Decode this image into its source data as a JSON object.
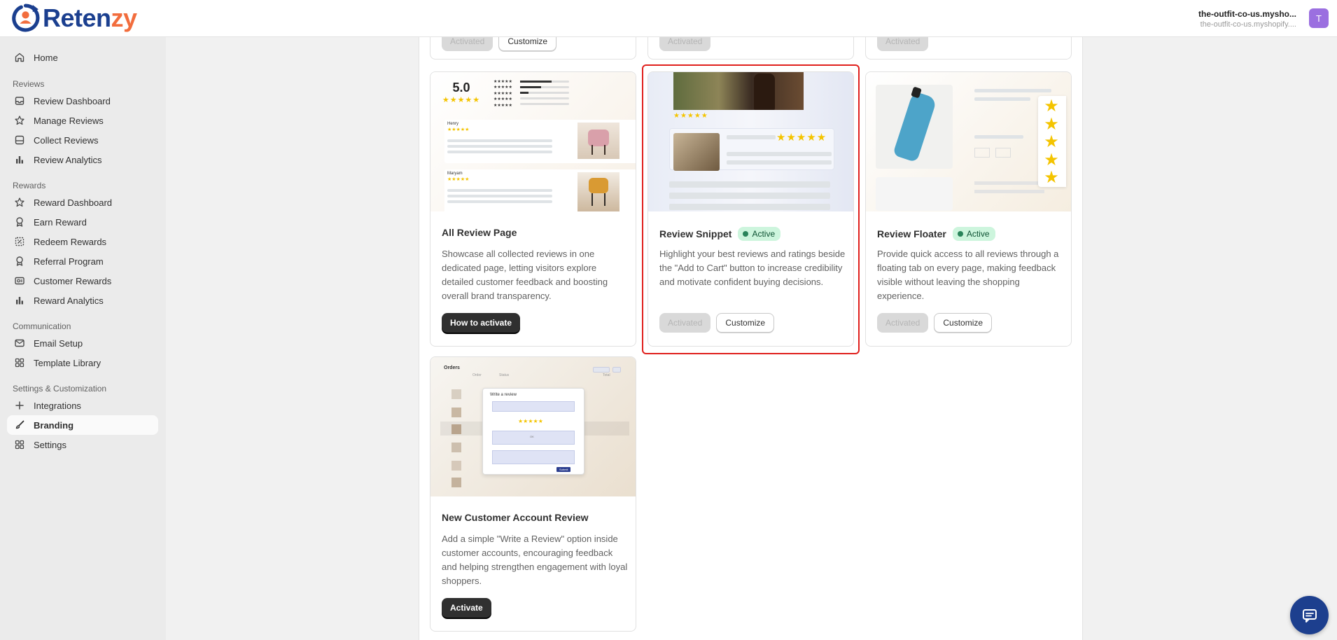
{
  "brand": {
    "name_part1": "Reten",
    "name_part2": "zy",
    "color_primary": "#1b3f8f",
    "color_accent": "#f26d3d"
  },
  "account": {
    "store_name": "the-outfit-co-us.mysho...",
    "store_url": "the-outfit-co-us.myshopify....",
    "avatar_initial": "T"
  },
  "sidebar": {
    "home": "Home",
    "sections": {
      "reviews": "Reviews",
      "rewards": "Rewards",
      "communication": "Communication",
      "settings": "Settings & Customization"
    },
    "items": [
      {
        "label": "Review Dashboard",
        "icon": "inbox-icon"
      },
      {
        "label": "Manage Reviews",
        "icon": "star-icon"
      },
      {
        "label": "Collect Reviews",
        "icon": "tray-icon"
      },
      {
        "label": "Review Analytics",
        "icon": "bar-chart-icon"
      },
      {
        "label": "Reward Dashboard",
        "icon": "star-icon"
      },
      {
        "label": "Earn Reward",
        "icon": "award-icon"
      },
      {
        "label": "Redeem Rewards",
        "icon": "coupon-icon"
      },
      {
        "label": "Referral Program",
        "icon": "award-icon"
      },
      {
        "label": "Customer Rewards",
        "icon": "gift-card-icon"
      },
      {
        "label": "Reward Analytics",
        "icon": "bar-chart-icon"
      },
      {
        "label": "Email Setup",
        "icon": "email-icon"
      },
      {
        "label": "Template Library",
        "icon": "apps-icon"
      },
      {
        "label": "Integrations",
        "icon": "plus-icon"
      },
      {
        "label": "Branding",
        "icon": "paint-brush-icon",
        "active": true
      },
      {
        "label": "Settings",
        "icon": "apps-icon"
      }
    ]
  },
  "buttons": {
    "activated": "Activated",
    "customize": "Customize",
    "how_to_activate": "How to activate",
    "activate": "Activate"
  },
  "cards": [
    {
      "title": "All Review Page",
      "description": "Showcase all collected reviews in one dedicated page, letting visitors explore detailed customer feedback and boosting overall brand transparency.",
      "rating": "5.0",
      "reviewer1": "Henry",
      "reviewer2": "Maryam"
    },
    {
      "title": "Review Snippet",
      "status": "Active",
      "description": "Highlight your best reviews and ratings beside the \"Add to Cart\" button to increase credibility and motivate confident buying decisions."
    },
    {
      "title": "Review Floater",
      "status": "Active",
      "description": "Provide quick access to all reviews through a floating tab on every page, making feedback visible without leaving the shopping experience."
    },
    {
      "title": "New Customer Account Review",
      "description": "Add a simple \"Write a Review\" option inside customer accounts, encouraging feedback and helping strengthen engagement with loyal shoppers.",
      "mock_heading": "Orders",
      "mock_dialog_title": "Write a review",
      "mock_col1": "Order",
      "mock_col2": "Status",
      "mock_col3": "Total",
      "mock_submit": "Submit",
      "mock_ok": "OK"
    }
  ]
}
